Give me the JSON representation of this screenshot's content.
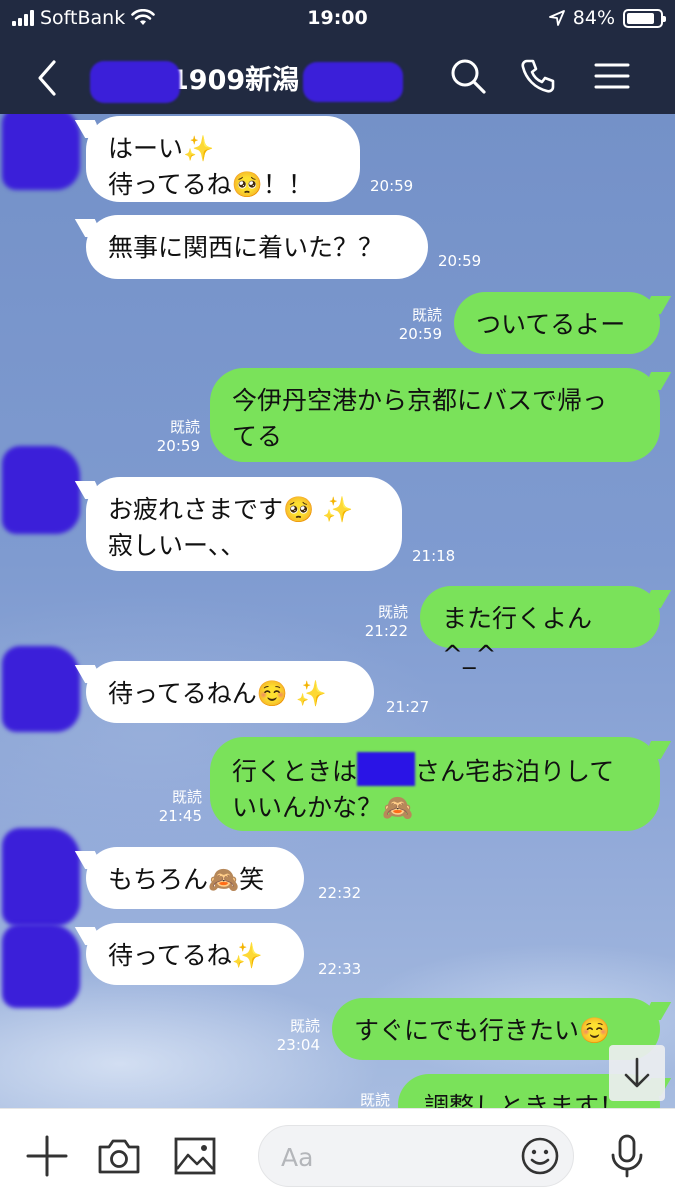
{
  "status_bar": {
    "carrier": "SoftBank",
    "time": "19:00",
    "battery": "84%",
    "battery_level": 0.84
  },
  "header": {
    "title": "1909新潟",
    "icons": [
      "back-icon",
      "search-icon",
      "phone-icon",
      "menu-icon"
    ]
  },
  "messages": [
    {
      "side": "in",
      "lines": [
        "はーい✨",
        "待ってるね🥺！！"
      ],
      "time": "20:59"
    },
    {
      "side": "in",
      "lines": [
        "無事に関西に着いた？？"
      ],
      "time": "20:59"
    },
    {
      "side": "out",
      "lines": [
        "ついてるよー"
      ],
      "read": "既読",
      "time": "20:59"
    },
    {
      "side": "out",
      "lines": [
        "今伊丹空港から京都にバスで帰っ",
        "てる"
      ],
      "read": "既読",
      "time": "20:59"
    },
    {
      "side": "in",
      "lines": [
        "お疲れさまです🥺 ✨",
        "寂しいー、、"
      ],
      "time": "21:18"
    },
    {
      "side": "out",
      "lines": [
        "また行くよん^_^"
      ],
      "read": "既読",
      "time": "21:22"
    },
    {
      "side": "in",
      "lines": [
        "待ってるねん☺️ ✨"
      ],
      "time": "21:27"
    },
    {
      "side": "out",
      "lines": [
        "行くときは",
        "さん宅お泊りして",
        "いいんかな？🙈"
      ],
      "read": "既読",
      "time": "21:45"
    },
    {
      "side": "in",
      "lines": [
        "もちろん🙈笑"
      ],
      "time": "22:32"
    },
    {
      "side": "in",
      "lines": [
        "待ってるね✨"
      ],
      "time": "22:33"
    },
    {
      "side": "out",
      "lines": [
        "すぐにでも行きたい☺️"
      ],
      "read": "既読",
      "time": "23:04"
    },
    {
      "side": "out",
      "lines": [
        "調整しときます！"
      ],
      "read": "既読",
      "time": ""
    }
  ],
  "input_bar": {
    "placeholder": "Aa",
    "icons": [
      "plus-icon",
      "camera-icon",
      "image-icon",
      "emoji-icon",
      "microphone-icon"
    ]
  },
  "colors": {
    "header_bg": "#212a41",
    "outgoing_bubble": "#7ae25a",
    "incoming_bubble": "#ffffff",
    "chat_bg": "#7f97c6"
  }
}
